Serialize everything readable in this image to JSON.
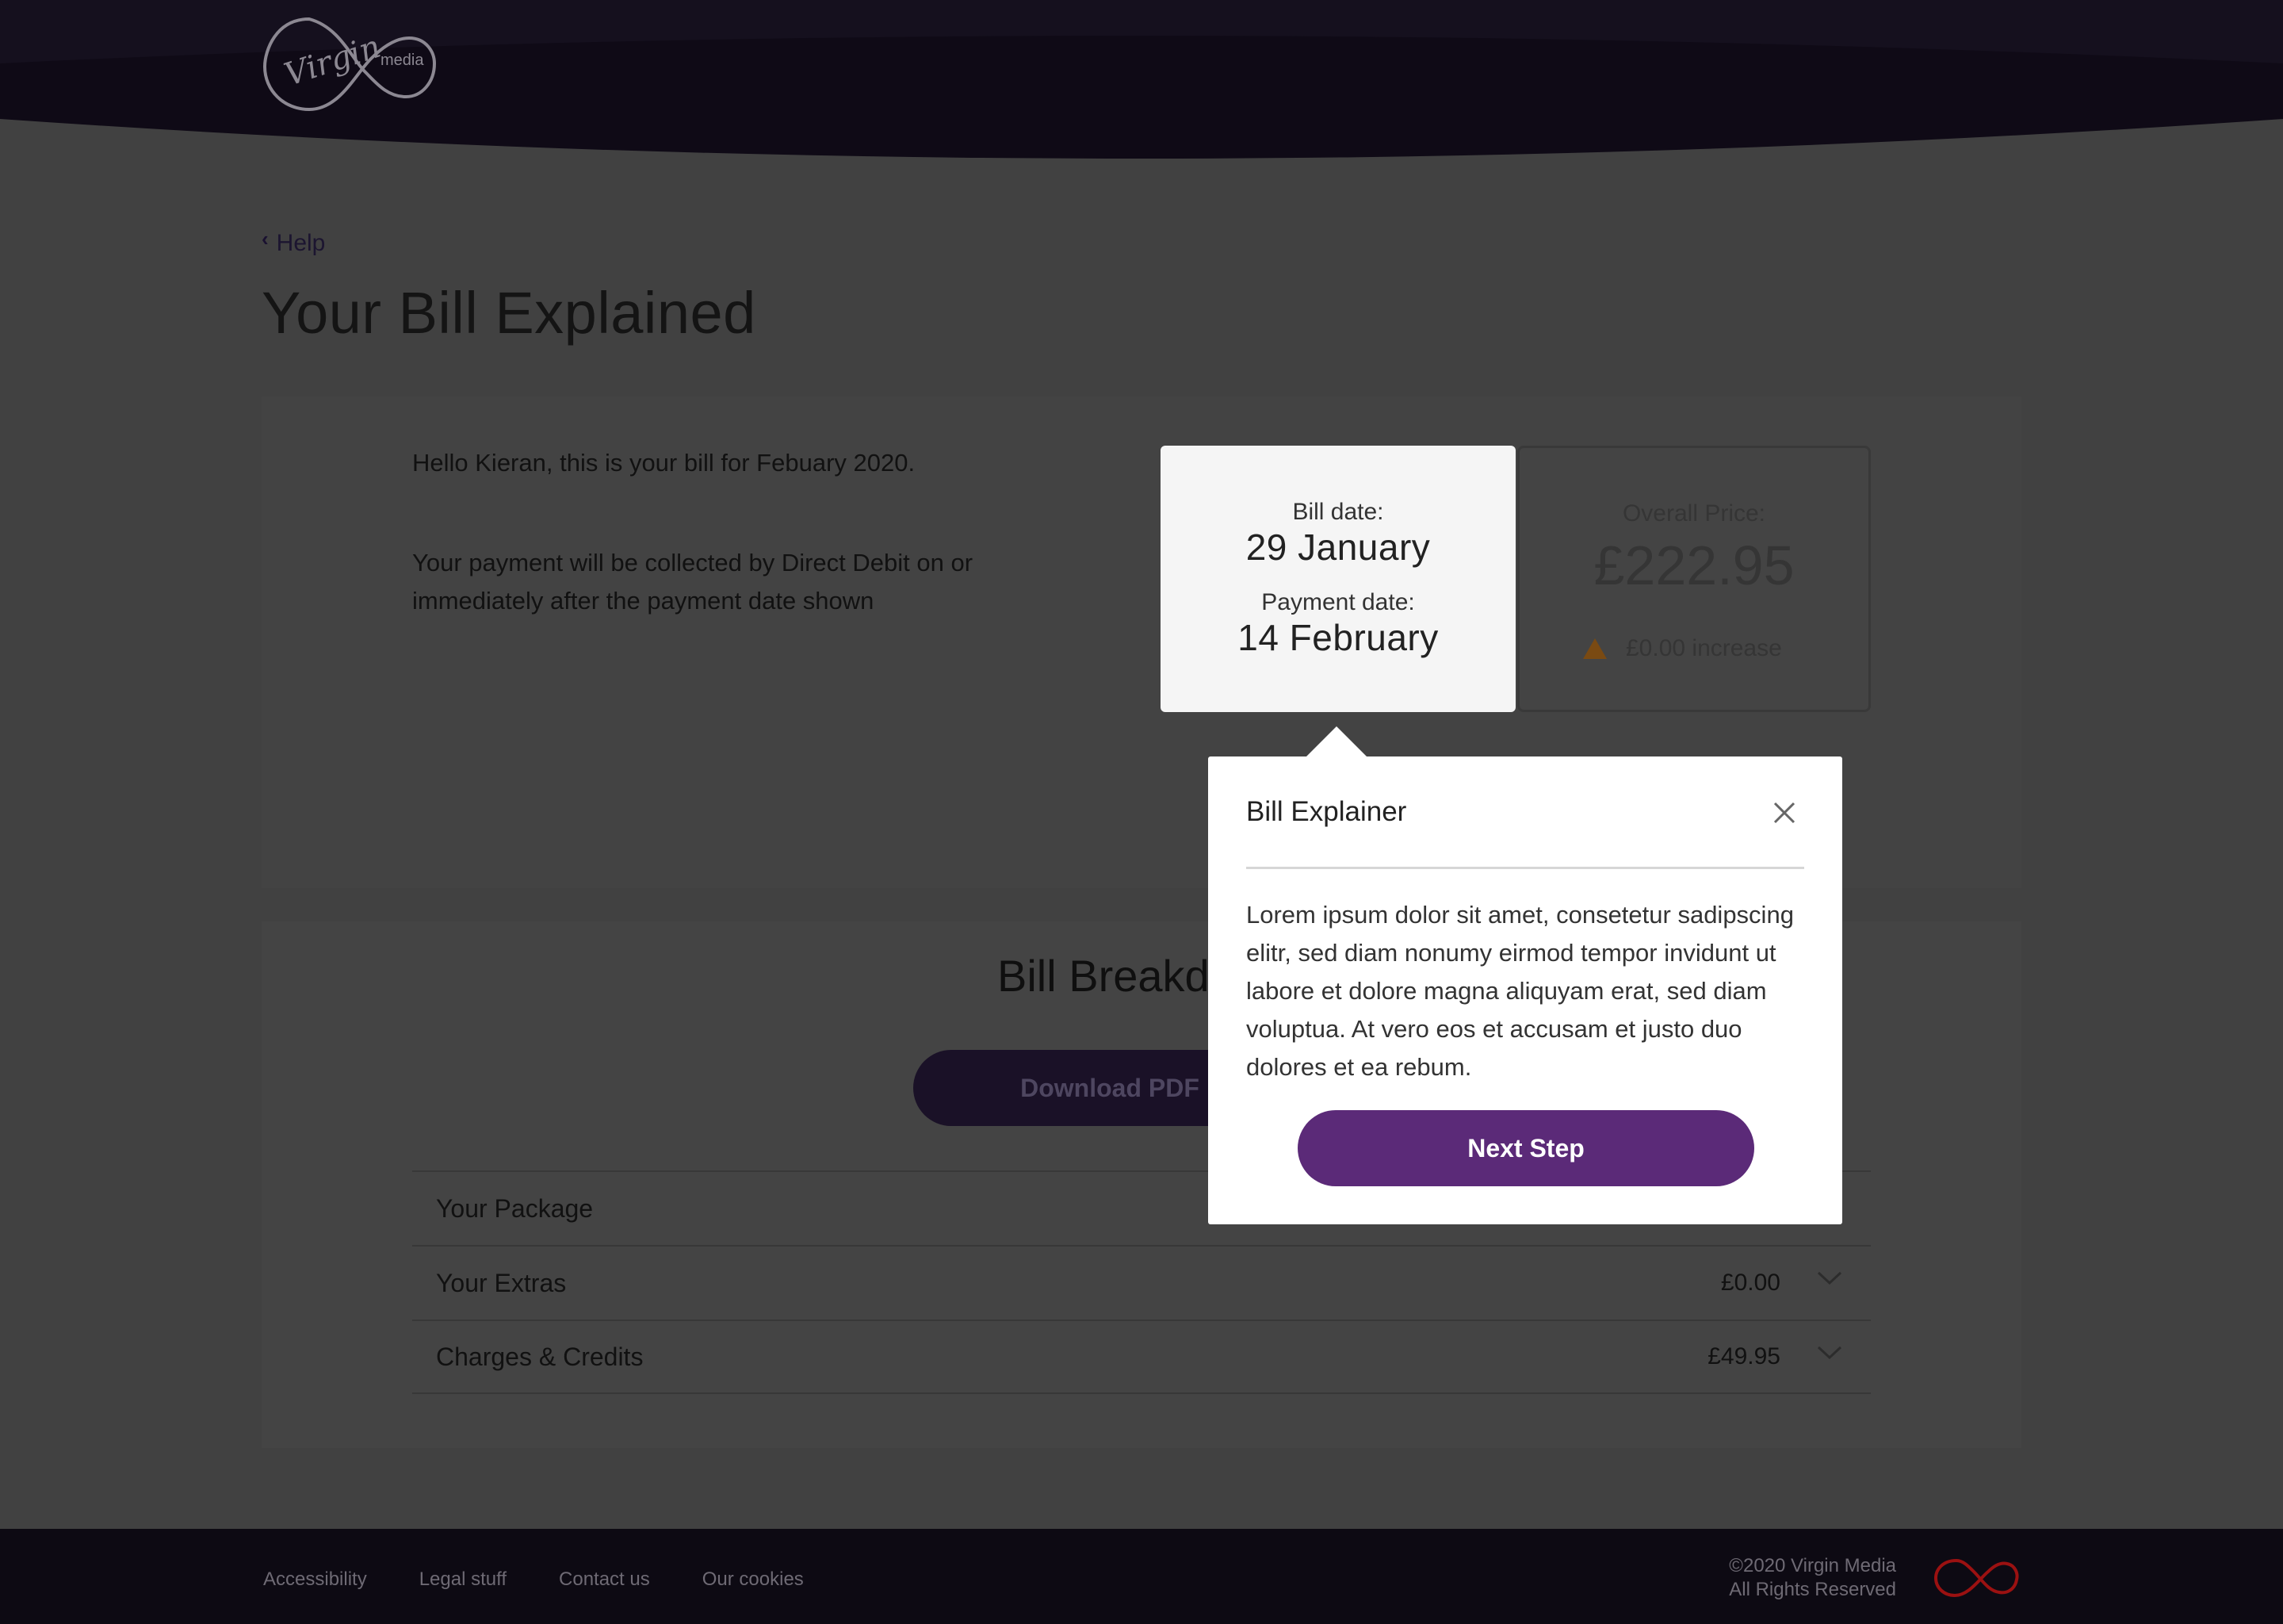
{
  "header": {
    "logo_text_primary": "Virgin",
    "logo_text_secondary": "media"
  },
  "nav": {
    "back_label": "Help"
  },
  "page": {
    "title": "Your Bill Explained"
  },
  "summary": {
    "greeting": "Hello Kieran, this is your bill for Febuary 2020.",
    "direct_debit_note": "Your payment will be collected by Direct Debit on or immediately after the payment date shown",
    "bill_date_label": "Bill date:",
    "bill_date_value": "29 January",
    "payment_date_label": "Payment date:",
    "payment_date_value": "14 February",
    "overall_price_label": "Overall Price:",
    "overall_price_value": "£222.95",
    "increase_text": "£0.00 increase"
  },
  "breakdown": {
    "title": "Bill Breakdown",
    "download_label": "Download PDF",
    "rows": [
      {
        "label": "Your Package",
        "amount": ""
      },
      {
        "label": "Your Extras",
        "amount": "£0.00"
      },
      {
        "label": "Charges & Credits",
        "amount": "£49.95"
      }
    ]
  },
  "popover": {
    "title": "Bill Explainer",
    "body": "Lorem ipsum dolor sit amet, consetetur sadipscing elitr, sed diam nonumy eirmod tempor invidunt ut labore et dolore magna aliquyam erat, sed diam voluptua. At vero eos et accusam et justo duo dolores et ea rebum.",
    "next_label": "Next Step"
  },
  "footer": {
    "links": [
      "Accessibility",
      "Legal stuff",
      "Contact us",
      "Our cookies"
    ],
    "copyright_line1": "©2020 Virgin Media",
    "copyright_line2": "All Rights Reserved"
  },
  "colors": {
    "brand_purple": "#5b2a78",
    "header_dark": "#0f0a16",
    "overlay_gray": "#414141",
    "footer_logo_red": "#9b1111"
  }
}
